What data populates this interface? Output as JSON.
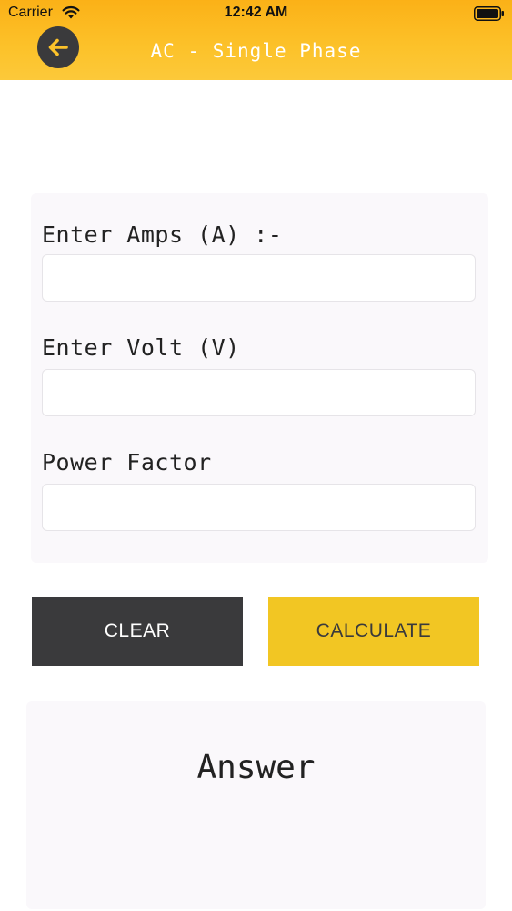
{
  "status_bar": {
    "carrier": "Carrier",
    "time": "12:42 AM"
  },
  "nav": {
    "title": "AC - Single Phase",
    "back_icon": "arrow-left-icon"
  },
  "form": {
    "amps_label": "Enter Amps (A) :-",
    "amps_value": "",
    "volt_label": "Enter Volt (V)",
    "volt_value": "",
    "pf_label": "Power Factor",
    "pf_value": ""
  },
  "buttons": {
    "clear_label": "CLEAR",
    "calculate_label": "CALCULATE"
  },
  "result": {
    "answer_label": "Answer"
  },
  "colors": {
    "header": "#fcc22a",
    "dark_button": "#3a3a3c",
    "accent_button": "#f2c623",
    "card_bg": "#faf8fb"
  }
}
